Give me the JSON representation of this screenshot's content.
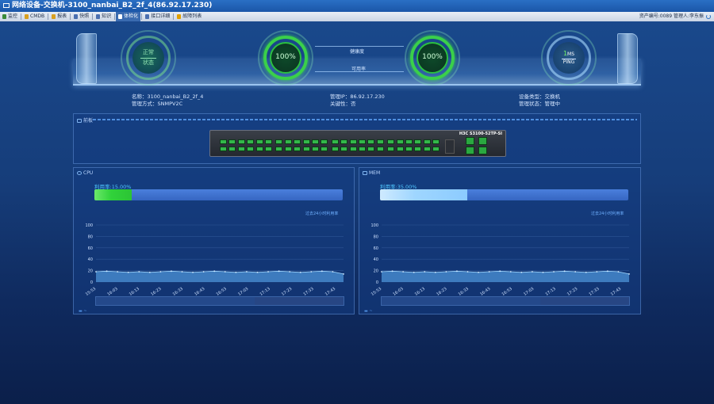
{
  "window": {
    "title": "网络设备-交换机-3100_nanbai_B2_2f_4(86.92.17.230)"
  },
  "toolbar": {
    "items": [
      {
        "label": "监控",
        "color": "#3a8a3a"
      },
      {
        "label": "CMDB",
        "color": "#d8a020"
      },
      {
        "label": "报表",
        "color": "#d8a020"
      },
      {
        "label": "快照",
        "color": "#4a6fb0"
      },
      {
        "label": "知识",
        "color": "#4a6fb0"
      },
      {
        "label": "体检化",
        "color": "#ffffff",
        "active": true
      },
      {
        "label": "接口详细",
        "color": "#4a6fb0"
      },
      {
        "label": "故障列表",
        "color": "#e0a000"
      }
    ],
    "right_text": "资产编号:0089  管理人:李东振"
  },
  "status": {
    "state_label": "正常",
    "state_sub": "状态",
    "health_value": "100%",
    "health_label": "健康度",
    "availability_value": "100%",
    "availability_label": "可用率",
    "ping_value": "1",
    "ping_unit": "MS",
    "ping_label": "PING"
  },
  "info": {
    "name": "名称：3100_nanbai_B2_2f_4",
    "method": "管理方式：SNMPV2C",
    "ip": "管理IP：86.92.17.230",
    "critical": "关键性：否",
    "type": "设备类型：交换机",
    "mgmt_state": "管理状态：管理中"
  },
  "panel": {
    "title": "前板",
    "switch_model": "H3C S3100-52TP-SI"
  },
  "cpu": {
    "title": "CPU",
    "usage_label": "利用率:15.00%",
    "usage_fraction": 0.15,
    "caption": "过去24小时利用率",
    "y_ticks": [
      "100",
      "80",
      "60",
      "40",
      "20",
      "0"
    ],
    "x_ticks": [
      "15:53",
      "16:03",
      "16:13",
      "16:23",
      "16:33",
      "16:43",
      "16:53",
      "17:03",
      "17:13",
      "17:23",
      "17:33",
      "17:43"
    ],
    "values": [
      18,
      19,
      18,
      17,
      18,
      17,
      18,
      19,
      18,
      17,
      18,
      19,
      18,
      17,
      18,
      17,
      18,
      19,
      18,
      17,
      18,
      19,
      18,
      14
    ]
  },
  "mem": {
    "title": "MEM",
    "usage_label": "利用率:35.00%",
    "usage_fraction": 0.35,
    "caption": "过去24小时利用率",
    "y_ticks": [
      "100",
      "80",
      "60",
      "40",
      "20",
      "0"
    ],
    "x_ticks": [
      "15:53",
      "16:03",
      "16:13",
      "16:23",
      "16:33",
      "16:43",
      "16:53",
      "17:03",
      "17:13",
      "17:23",
      "17:33",
      "17:43"
    ],
    "values": [
      18,
      19,
      18,
      17,
      18,
      17,
      18,
      19,
      18,
      17,
      18,
      19,
      18,
      17,
      18,
      17,
      18,
      19,
      18,
      17,
      18,
      19,
      18,
      14
    ]
  },
  "chart_data": [
    {
      "type": "area",
      "title": "",
      "x": [
        "15:53",
        "16:03",
        "16:13",
        "16:23",
        "16:33",
        "16:43",
        "16:53",
        "17:03",
        "17:13",
        "17:23",
        "17:33",
        "17:43"
      ],
      "series": [
        {
          "values": [
            18,
            18,
            17,
            18,
            18,
            18,
            19,
            18,
            18,
            18,
            19,
            15
          ]
        }
      ],
      "ylim": [
        0,
        100
      ]
    },
    {
      "type": "area",
      "title": "",
      "x": [
        "15:53",
        "16:03",
        "16:13",
        "16:23",
        "16:33",
        "16:43",
        "16:53",
        "17:03",
        "17:13",
        "17:23",
        "17:33",
        "17:43"
      ],
      "series": [
        {
          "values": [
            18,
            18,
            17,
            18,
            18,
            18,
            19,
            18,
            18,
            18,
            19,
            15
          ]
        }
      ],
      "ylim": [
        0,
        100
      ]
    }
  ]
}
